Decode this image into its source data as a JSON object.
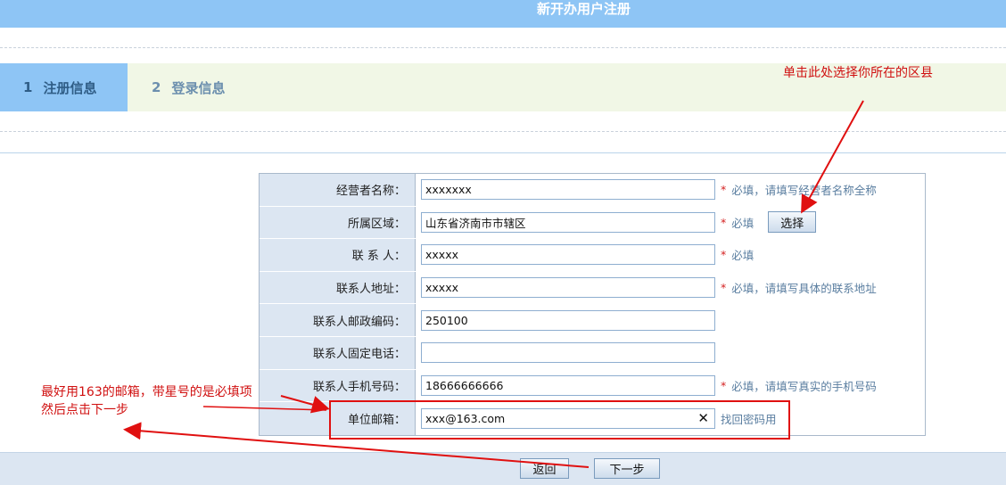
{
  "header": {
    "title": "新开办用户注册"
  },
  "steps": [
    {
      "number": "1",
      "label": "注册信息"
    },
    {
      "number": "2",
      "label": "登录信息"
    }
  ],
  "form": {
    "rows": [
      {
        "label": "经营者名称：",
        "value": "xxxxxxx",
        "required": true,
        "hint": "必填，请填写经营者名称全称"
      },
      {
        "label": "所属区域：",
        "value": "山东省济南市市辖区",
        "required": true,
        "hint": "必填",
        "button": "选择"
      },
      {
        "label": "联 系 人：",
        "value": "xxxxx",
        "required": true,
        "hint": "必填"
      },
      {
        "label": "联系人地址：",
        "value": "xxxxx",
        "required": true,
        "hint": "必填，请填写具体的联系地址"
      },
      {
        "label": "联系人邮政编码：",
        "value": "250100",
        "required": false,
        "hint": ""
      },
      {
        "label": "联系人固定电话：",
        "value": "",
        "required": false,
        "hint": ""
      },
      {
        "label": "联系人手机号码：",
        "value": "18666666666",
        "required": true,
        "hint": "必填，请填写真实的手机号码"
      },
      {
        "label": "单位邮箱：",
        "value": "xxx@163.com",
        "required": false,
        "hint": "找回密码用",
        "clear": "✕"
      }
    ],
    "star": "*"
  },
  "footer": {
    "back_label": "返回",
    "next_label": "下一步"
  },
  "annotations": {
    "select_district": "单击此处选择你所在的区县",
    "email_note_line1": "最好用163的邮箱，带星号的是必填项",
    "email_note_line2": "然后点击下一步"
  },
  "colors": {
    "header_bg": "#8ec5f5",
    "step_bg": "#f1f7e6",
    "annotation": "#d01010"
  }
}
